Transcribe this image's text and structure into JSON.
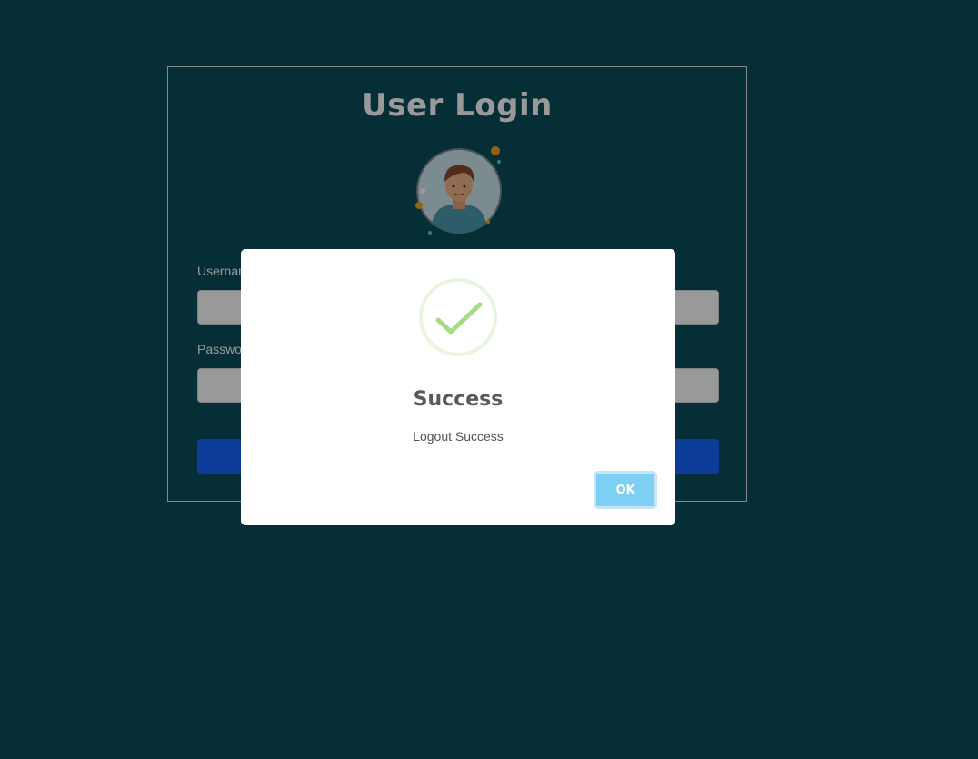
{
  "colors": {
    "page_background": "#0a4d5c",
    "login_button": "#1565ff",
    "success_accent": "#a5dc86",
    "ok_button": "#7ecff4"
  },
  "login": {
    "title": "User Login",
    "avatar_icon": "user-avatar-icon",
    "username_label": "Username",
    "password_label": "Password",
    "username_value": "",
    "password_value": "",
    "login_button_label": ""
  },
  "modal": {
    "icon": "checkmark-success-icon",
    "title": "Success",
    "message": "Logout Success",
    "ok_label": "OK"
  }
}
